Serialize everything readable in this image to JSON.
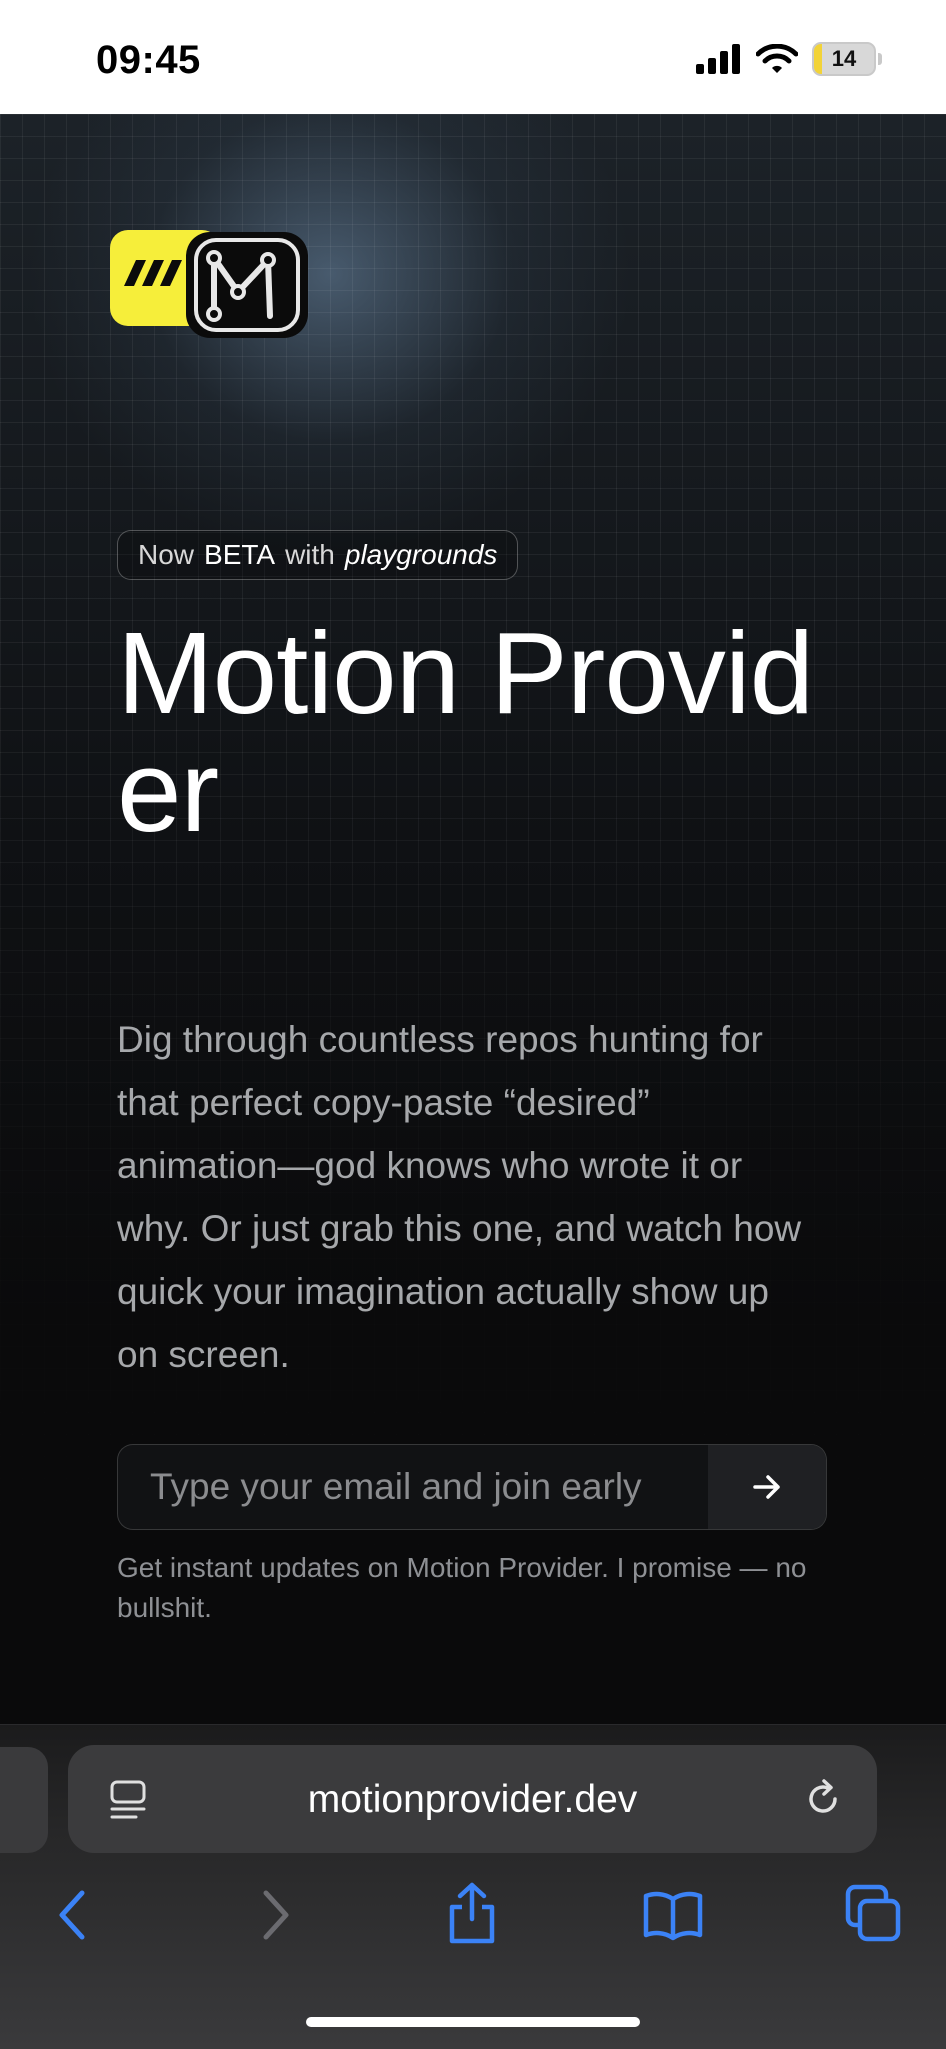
{
  "status_bar": {
    "time": "09:45",
    "battery": {
      "level_text": "14",
      "level_fraction": 0.14,
      "charging": true
    },
    "icons": [
      "cellular-signal-icon",
      "wifi-icon",
      "battery-charging-icon"
    ]
  },
  "hero": {
    "badge": {
      "prefix": "Now",
      "highlight": "BETA",
      "middle": "with",
      "emphasis": "playgrounds"
    },
    "title": "Motion Provider",
    "description": "Dig through countless repos hunting for that perfect copy-paste “desired” animation—god knows who wrote it or why. Or just grab this one, and watch how quick your imagination actually show up on screen.",
    "email_form": {
      "placeholder": "Type your email and join early",
      "submit_icon": "arrow-right-icon"
    },
    "note": "Get instant updates on Motion Provider. I promise — no bullshit.",
    "logo_colors": {
      "yellow": "#f6ee3a",
      "black": "#0b0b0b"
    }
  },
  "browser": {
    "url": "motionprovider.dev",
    "toolbar": [
      "back-icon",
      "forward-icon",
      "share-icon",
      "bookmarks-icon",
      "tabs-icon"
    ],
    "accent_color": "#3b82f6"
  }
}
